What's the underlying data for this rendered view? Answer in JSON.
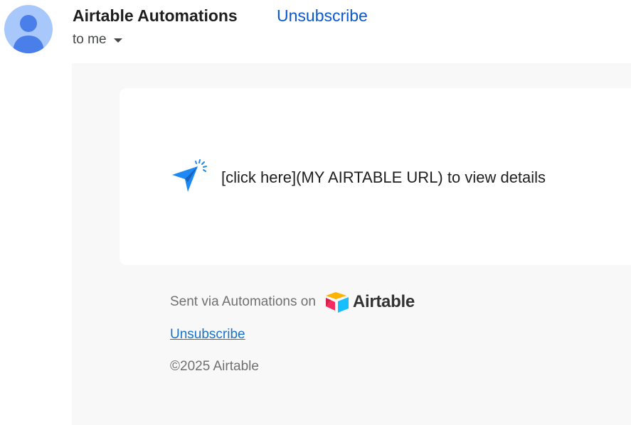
{
  "header": {
    "avatar_icon": "person-avatar-icon",
    "sender_name": "Airtable Automations",
    "unsubscribe_label": "Unsubscribe",
    "recipient_label": "to me",
    "recipient_dropdown_icon": "caret-down-icon"
  },
  "email": {
    "message_icon": "send-paper-plane-icon",
    "message_text": "[click here](MY AIRTABLE URL) to view details",
    "footer": {
      "sent_via_text": "Sent via Automations on",
      "logo_icon": "airtable-logo-icon",
      "logo_text": "Airtable",
      "unsubscribe_link": "Unsubscribe",
      "copyright": "©2025 Airtable"
    }
  },
  "colors": {
    "link_blue": "#0b57d0",
    "avatar_bg": "#a8c7fa",
    "avatar_fg": "#4a7ee8",
    "body_bg": "#f8f8f8",
    "icon_blue": "#1e88f5"
  }
}
